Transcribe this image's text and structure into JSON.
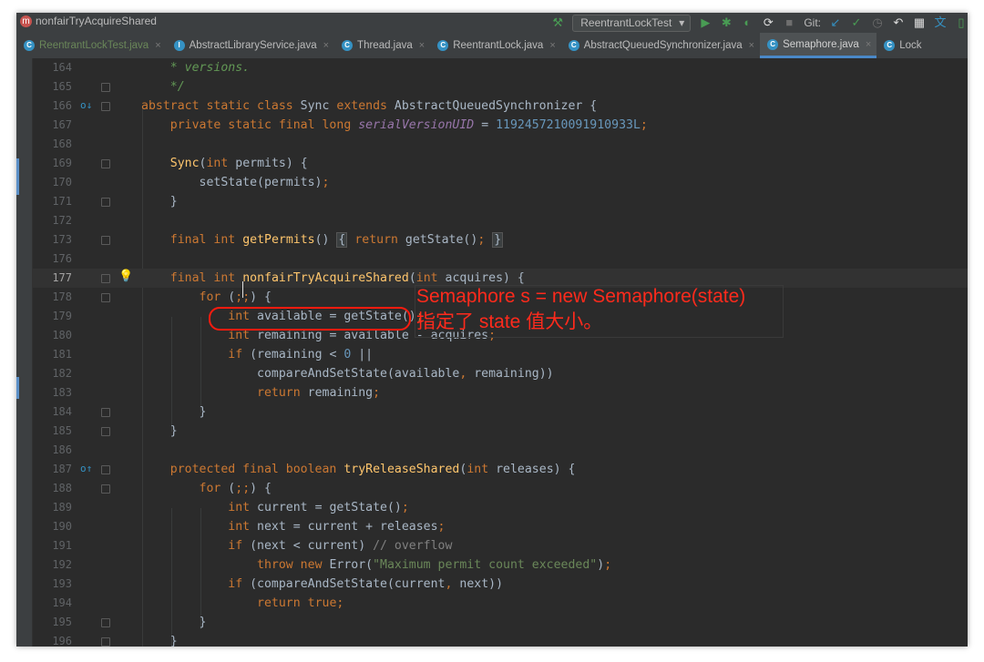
{
  "titlebar": {
    "breadcrumb_badge": "m",
    "breadcrumb": "nonfairTryAcquireShared",
    "run_config": "ReentrantLockTest",
    "git_label": "Git:",
    "icons": [
      "hammer-icon",
      "run-icon",
      "debug-icon",
      "coverage-icon",
      "profile-icon",
      "stop-icon",
      "update-icon",
      "commit-icon",
      "history-icon",
      "rollback-icon",
      "project-structure-icon",
      "translate-icon"
    ]
  },
  "tabs": [
    {
      "label": "ReentrantLockTest.java",
      "badge": "C",
      "style": "green"
    },
    {
      "label": "AbstractLibraryService.java",
      "badge": "I",
      "style": ""
    },
    {
      "label": "Thread.java",
      "badge": "C",
      "style": ""
    },
    {
      "label": "ReentrantLock.java",
      "badge": "C",
      "style": ""
    },
    {
      "label": "AbstractQueuedSynchronizer.java",
      "badge": "C",
      "style": ""
    },
    {
      "label": "Semaphore.java",
      "badge": "C",
      "style": "active"
    },
    {
      "label": "Lock",
      "badge": "C",
      "style": ""
    }
  ],
  "editor": {
    "lines": [
      {
        "n": "164",
        "html": "    <span class='cm'>* versions.</span>"
      },
      {
        "n": "165",
        "html": "    <span class='cm'>*/</span>",
        "fold": true
      },
      {
        "n": "166",
        "html": "<span class='kw'>abstract static class</span> Sync <span class='kw'>extends</span> AbstractQueuedSynchronizer {",
        "fold": true,
        "gutter": "o↓"
      },
      {
        "n": "167",
        "html": "    <span class='kw'>private static final long</span> <span class='fld'>serialVersionUID</span> = <span class='num'>1192457210091910933L</span><span class='kw'>;</span>"
      },
      {
        "n": "168",
        "html": ""
      },
      {
        "n": "169",
        "html": "    <span class='fn'>Sync</span>(<span class='kw'>int</span> permits) {",
        "fold": true
      },
      {
        "n": "170",
        "html": "        setState(permits)<span class='kw'>;</span>"
      },
      {
        "n": "171",
        "html": "    }",
        "fold": true
      },
      {
        "n": "172",
        "html": ""
      },
      {
        "n": "173",
        "html": "    <span class='kw'>final int</span> <span class='fn'>getPermits</span>() <span class='fb'>{</span> <span class='kw'>return</span> getState()<span class='kw'>;</span> <span class='fb'>}</span>",
        "fold": true
      },
      {
        "n": "176",
        "html": ""
      },
      {
        "n": "177",
        "html": "    <span class='kw'>final int</span> <span class='fn'>nonfairTryAcquireShared</span>(<span class='kw'>int</span> acquires) {",
        "fold": true,
        "current": true,
        "bulb": true
      },
      {
        "n": "178",
        "html": "        <span class='kw'>for</span> (<span class='kw'>;;</span>) {",
        "fold": true
      },
      {
        "n": "179",
        "html": "            <span class='kw'>int</span> available = getState()<span class='kw'>;</span>"
      },
      {
        "n": "180",
        "html": "            <span class='kw'>int</span> remaining = available - acquires<span class='kw'>;</span>"
      },
      {
        "n": "181",
        "html": "            <span class='kw'>if</span> (remaining &lt; <span class='num'>0</span> ||"
      },
      {
        "n": "182",
        "html": "                compareAndSetState(available<span class='kw'>,</span> remaining))"
      },
      {
        "n": "183",
        "html": "                <span class='kw'>return</span> remaining<span class='kw'>;</span>"
      },
      {
        "n": "184",
        "html": "        }",
        "fold": true
      },
      {
        "n": "185",
        "html": "    }",
        "fold": true
      },
      {
        "n": "186",
        "html": ""
      },
      {
        "n": "187",
        "html": "    <span class='kw'>protected final boolean</span> <span class='fn'>tryReleaseShared</span>(<span class='kw'>int</span> releases) {",
        "fold": true,
        "gutter": "o↑"
      },
      {
        "n": "188",
        "html": "        <span class='kw'>for</span> (<span class='kw'>;;</span>) {",
        "fold": true
      },
      {
        "n": "189",
        "html": "            <span class='kw'>int</span> current = getState()<span class='kw'>;</span>"
      },
      {
        "n": "190",
        "html": "            <span class='kw'>int</span> next = current + releases<span class='kw'>;</span>"
      },
      {
        "n": "191",
        "html": "            <span class='kw'>if</span> (next &lt; current) <span class='cm2'>// overflow</span>"
      },
      {
        "n": "192",
        "html": "                <span class='kw'>throw new</span> Error(<span class='st'>\"Maximum permit count exceeded\"</span>)<span class='kw'>;</span>"
      },
      {
        "n": "193",
        "html": "            <span class='kw'>if</span> (compareAndSetState(current<span class='kw'>,</span> next))"
      },
      {
        "n": "194",
        "html": "                <span class='kw'>return true;</span>"
      },
      {
        "n": "195",
        "html": "        }",
        "fold": true
      },
      {
        "n": "196",
        "html": "    }",
        "fold": true
      }
    ]
  },
  "annotation": {
    "line1": "Semaphore s = new Semaphore(state)",
    "line2": "指定了 state 值大小。",
    "color": "#ff2a1c"
  }
}
